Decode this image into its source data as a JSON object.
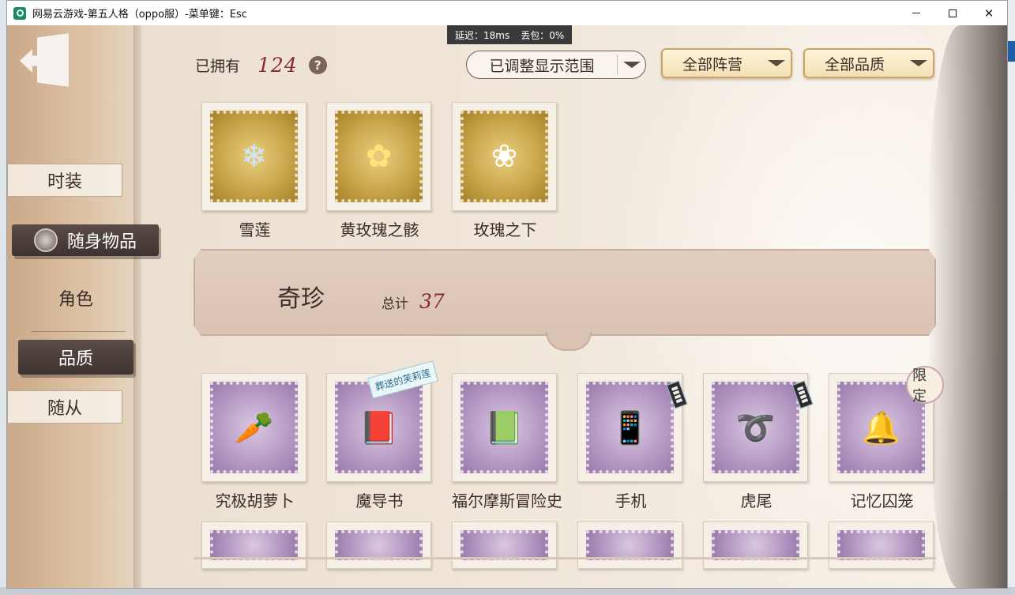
{
  "window": {
    "title": "网易云游戏-第五人格（oppo服）-菜单键：Esc",
    "controls": {
      "minimize": "minimize",
      "maximize": "maximize",
      "close": "✕"
    }
  },
  "latency": {
    "delay": "延迟：18ms",
    "loss": "丢包：0%"
  },
  "sidebar": {
    "items": [
      {
        "label": "时装"
      },
      {
        "label": "随身物品",
        "active": true
      },
      {
        "label": "角色"
      },
      {
        "label": "品质",
        "selected": true
      },
      {
        "label": "随从"
      }
    ]
  },
  "header": {
    "owned_label": "已拥有",
    "owned_count": "124",
    "help": "?",
    "filters": [
      {
        "label": "已调整显示范围"
      },
      {
        "label": "全部阵营"
      },
      {
        "label": "全部品质"
      }
    ]
  },
  "top_items": [
    {
      "name": "雪莲",
      "icon": "❄"
    },
    {
      "name": "黄玫瑰之骸",
      "icon": "✿"
    },
    {
      "name": "玫瑰之下",
      "icon": "❀"
    }
  ],
  "section": {
    "title": "奇珍",
    "total_label": "总计",
    "total": "37"
  },
  "rare_items": [
    {
      "name": "究极胡萝卜",
      "icon": "🥕"
    },
    {
      "name": "魔导书",
      "icon": "📕",
      "tag": "葬送的芙莉莲"
    },
    {
      "name": "福尔摩斯冒险史",
      "icon": "📗"
    },
    {
      "name": "手机",
      "icon": "📱"
    },
    {
      "name": "虎尾",
      "icon": "➰"
    },
    {
      "name": "记忆囚笼",
      "icon": "🔔",
      "tag": "限定"
    }
  ],
  "colors": {
    "accent_red": "#8b2a2a",
    "gold_frame": "#c8a54a",
    "purple_frame": "#b79ac4"
  }
}
